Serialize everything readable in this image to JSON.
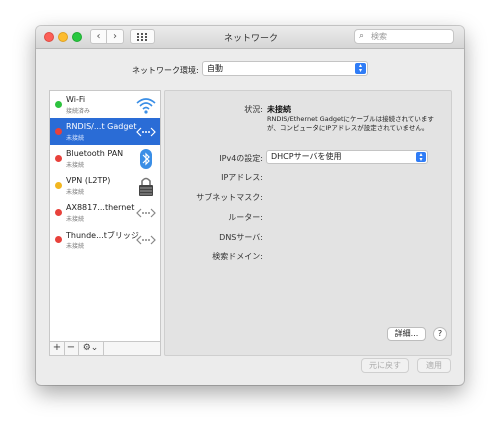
{
  "window": {
    "title": "ネットワーク"
  },
  "toolbar": {
    "back_icon": "‹",
    "forward_icon": "›",
    "search_placeholder": "検索"
  },
  "location": {
    "label": "ネットワーク環境:",
    "value": "自動"
  },
  "services": [
    {
      "name": "Wi-Fi",
      "status": "接続済み",
      "dot_color": "#2dc23e",
      "icon": "wifi-icon"
    },
    {
      "name": "RNDIS/...t Gadget",
      "status": "未接続",
      "dot_color": "#e8413b",
      "icon": "ethernet-icon",
      "selected": true
    },
    {
      "name": "Bluetooth PAN",
      "status": "未接続",
      "dot_color": "#e8413b",
      "icon": "bluetooth-icon"
    },
    {
      "name": "VPN (L2TP)",
      "status": "未接続",
      "dot_color": "#f2b620",
      "icon": "vpn-lock-icon"
    },
    {
      "name": "AX8817...thernet",
      "status": "未接続",
      "dot_color": "#e8413b",
      "icon": "ethernet-icon"
    },
    {
      "name": "Thunde...tブリッジ",
      "status": "未接続",
      "dot_color": "#e8413b",
      "icon": "ethernet-icon"
    }
  ],
  "sidebar_controls": {
    "add": "+",
    "remove": "−",
    "gear": "⚙⌄"
  },
  "details": {
    "status_label": "状況:",
    "status_value": "未接続",
    "status_description": "RNDIS/Ethernet Gadgetにケーブルは接続されていますが、コンピュータにIPアドレスが設定されていません。",
    "ipv4_label": "IPv4の設定:",
    "ipv4_value": "DHCPサーバを使用",
    "ip_label": "IPアドレス:",
    "subnet_label": "サブネットマスク:",
    "router_label": "ルーター:",
    "dns_label": "DNSサーバ:",
    "search_domain_label": "検索ドメイン:"
  },
  "buttons": {
    "advanced": "詳細...",
    "help": "?",
    "revert": "元に戻す",
    "apply": "適用"
  },
  "colors": {
    "selection": "#2a6cd6",
    "accent": "#2f7cf6"
  }
}
